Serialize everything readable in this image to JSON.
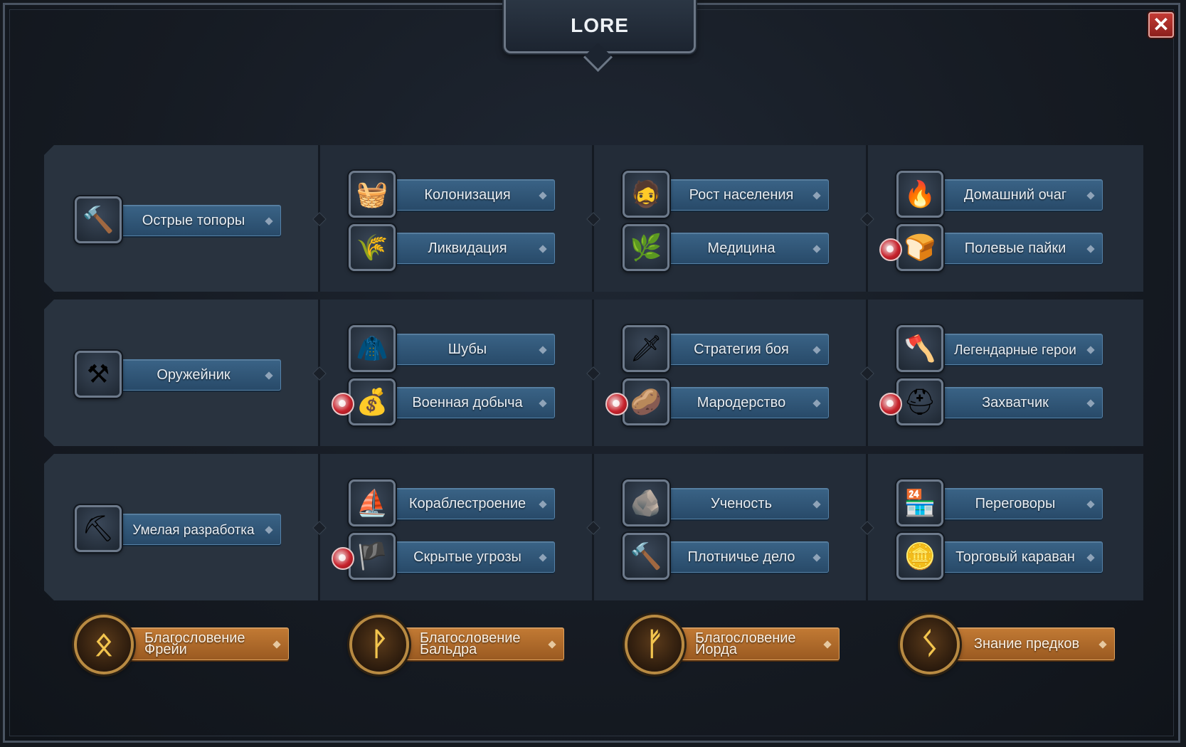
{
  "header": {
    "title": "LORE",
    "close_label": "✕"
  },
  "rows": [
    {
      "first": {
        "label": "Острые топоры",
        "icon": "hammer-icon",
        "glyph": "🔨"
      },
      "columns": [
        [
          {
            "label": "Колонизация",
            "icon": "food-basket-icon",
            "glyph": "🧺",
            "locked": false
          },
          {
            "label": "Ликвидация",
            "icon": "grain-sack-icon",
            "glyph": "🌾",
            "locked": false
          }
        ],
        [
          {
            "label": "Рост населения",
            "icon": "viking-face-icon",
            "glyph": "🧔",
            "locked": false
          },
          {
            "label": "Медицина",
            "icon": "herb-leaf-icon",
            "glyph": "🌿",
            "locked": false
          }
        ],
        [
          {
            "label": "Домашний очаг",
            "icon": "fire-icon",
            "glyph": "🔥",
            "locked": false
          },
          {
            "label": "Полевые пайки",
            "icon": "bread-sack-icon",
            "glyph": "🍞",
            "locked": true
          }
        ]
      ]
    },
    {
      "first": {
        "label": "Оружейник",
        "icon": "anvil-icon",
        "glyph": "⚒"
      },
      "columns": [
        [
          {
            "label": "Шубы",
            "icon": "fur-pelt-icon",
            "glyph": "🧥",
            "locked": false
          },
          {
            "label": "Военная добыча",
            "icon": "loot-bag-icon",
            "glyph": "💰",
            "locked": true
          }
        ],
        [
          {
            "label": "Стратегия боя",
            "icon": "sword-icon",
            "glyph": "🗡",
            "locked": false
          },
          {
            "label": "Мародерство",
            "icon": "plunder-pile-icon",
            "glyph": "🥔",
            "locked": true
          }
        ],
        [
          {
            "label": "Легендарные герои",
            "icon": "double-axe-icon",
            "glyph": "🪓",
            "locked": false
          },
          {
            "label": "Захватчик",
            "icon": "horned-helmet-icon",
            "glyph": "⛑",
            "locked": true
          }
        ]
      ]
    },
    {
      "first": {
        "label": "Умелая разработка",
        "icon": "pickaxe-icon",
        "glyph": "⛏"
      },
      "columns": [
        [
          {
            "label": "Кораблестроение",
            "icon": "ship-sail-icon",
            "glyph": "⛵",
            "locked": false
          },
          {
            "label": "Скрытые угрозы",
            "icon": "banner-icon",
            "glyph": "🏴",
            "locked": true
          }
        ],
        [
          {
            "label": "Ученость",
            "icon": "rune-stone-icon",
            "glyph": "🪨",
            "locked": false
          },
          {
            "label": "Плотничье дело",
            "icon": "carpenter-hammer-icon",
            "glyph": "🔨",
            "locked": false
          }
        ],
        [
          {
            "label": "Переговоры",
            "icon": "market-stall-icon",
            "glyph": "🏪",
            "locked": false
          },
          {
            "label": "Торговый караван",
            "icon": "coins-trade-icon",
            "glyph": "🪙",
            "locked": false
          }
        ]
      ]
    }
  ],
  "blessings": [
    {
      "label": "Благословение Фрейи",
      "icon": "othala-rune-icon",
      "glyph": "ᛟ"
    },
    {
      "label": "Благословение Бальдра",
      "icon": "wunjo-rune-icon",
      "glyph": "ᚹ"
    },
    {
      "label": "Благословение Йорда",
      "icon": "fehu-rune-icon",
      "glyph": "ᚠ"
    },
    {
      "label": "Знание предков",
      "icon": "sowilo-rune-icon",
      "glyph": "ᛊ"
    }
  ]
}
